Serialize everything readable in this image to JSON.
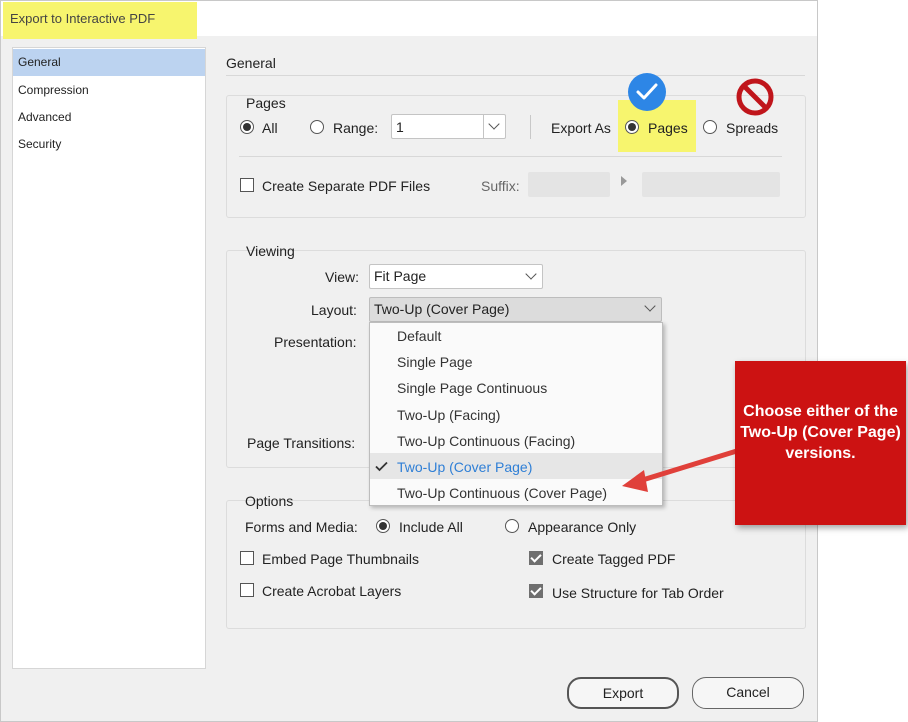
{
  "window": {
    "title": "Export to Interactive PDF"
  },
  "sidebar": {
    "items": [
      {
        "label": "General"
      },
      {
        "label": "Compression"
      },
      {
        "label": "Advanced"
      },
      {
        "label": "Security"
      }
    ]
  },
  "main": {
    "heading": "General"
  },
  "pages": {
    "legend": "Pages",
    "all_label": "All",
    "range_label": "Range:",
    "range_value": "1",
    "export_as_label": "Export As",
    "pages_label": "Pages",
    "spreads_label": "Spreads",
    "separate_label": "Create Separate PDF Files",
    "suffix_label": "Suffix:"
  },
  "viewing": {
    "legend": "Viewing",
    "view_label": "View:",
    "view_value": "Fit Page",
    "layout_label": "Layout:",
    "layout_value": "Two-Up (Cover Page)",
    "presentation_label": "Presentation:",
    "transitions_label": "Page Transitions:",
    "layout_options": [
      "Default",
      "Single Page",
      "Single Page Continuous",
      "Two-Up (Facing)",
      "Two-Up Continuous (Facing)",
      "Two-Up (Cover Page)",
      "Two-Up Continuous (Cover Page)"
    ]
  },
  "options": {
    "legend": "Options",
    "forms_label": "Forms and Media:",
    "include_all_label": "Include All",
    "appearance_only_label": "Appearance Only",
    "embed_thumbnails_label": "Embed Page Thumbnails",
    "tagged_pdf_label": "Create Tagged PDF",
    "acrobat_layers_label": "Create Acrobat Layers",
    "structure_tab_label": "Use Structure for Tab Order"
  },
  "buttons": {
    "export_label": "Export",
    "cancel_label": "Cancel"
  },
  "annotation": {
    "callout_text": "Choose either of the  Two-Up (Cover Page) versions."
  },
  "colors": {
    "highlight": "#f7f56e",
    "selected_sidebar": "#bcd3f0",
    "menu_selected_text": "#2f7fd6",
    "callout_red": "#cc1212",
    "check_blue": "#2d86e6",
    "no_sign_red": "#c0151b"
  }
}
